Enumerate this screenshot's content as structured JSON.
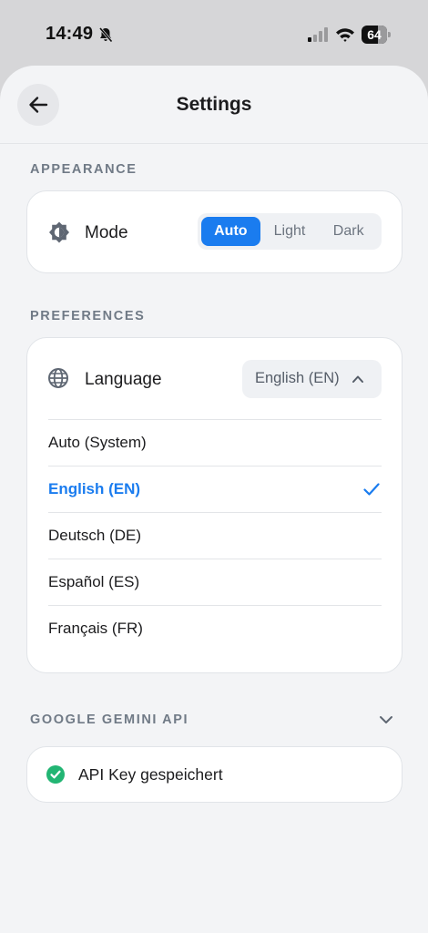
{
  "status_bar": {
    "time": "14:49",
    "battery_level": 64,
    "battery_text": "64"
  },
  "nav": {
    "title": "Settings"
  },
  "appearance": {
    "section_label": "APPEARANCE",
    "mode_label": "Mode",
    "mode_options": [
      "Auto",
      "Light",
      "Dark"
    ],
    "selected_mode": "Auto"
  },
  "preferences": {
    "section_label": "PREFERENCES",
    "language_label": "Language",
    "selected_language": "English (EN)",
    "language_options": [
      "Auto (System)",
      "English (EN)",
      "Deutsch (DE)",
      "Español (ES)",
      "Français (FR)"
    ]
  },
  "gemini": {
    "section_label": "GOOGLE GEMINI API",
    "status_text": "API Key gespeichert"
  },
  "colors": {
    "accent": "#1a7cef",
    "success": "#22b573",
    "background": "#f3f4f6"
  },
  "icons": {
    "back": "arrow-left-icon",
    "mode": "contrast-icon",
    "language": "globe-icon",
    "dropdown": "chevron-up-icon",
    "selected": "check-icon",
    "collapse": "chevron-down-icon",
    "api_status": "check-circle-icon"
  }
}
